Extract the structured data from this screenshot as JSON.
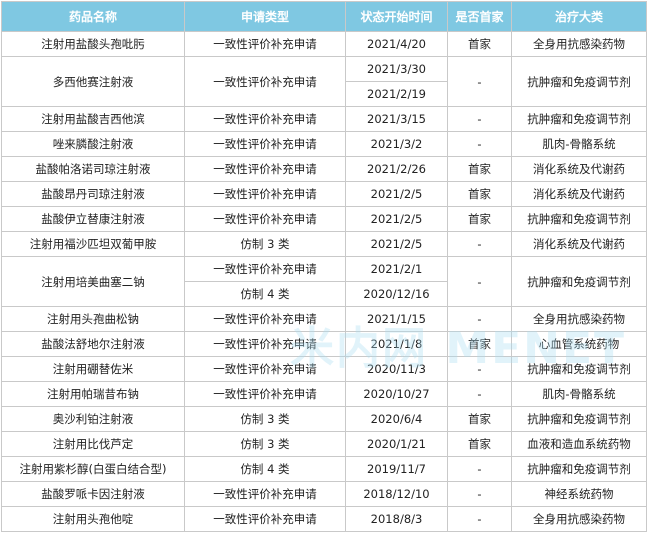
{
  "table": {
    "headers": [
      "药品名称",
      "申请类型",
      "状态开始时间",
      "是否首家",
      "治疗大类"
    ],
    "rows": [
      {
        "name": "注射用盐酸头孢吡肟",
        "items": [
          {
            "type": "一致性评价补充申请",
            "date": "2021/4/20"
          }
        ],
        "first": "首家",
        "category": "全身用抗感染药物"
      },
      {
        "name": "多西他赛注射液",
        "items": [
          {
            "type": "一致性评价补充申请",
            "date": "2021/3/30"
          },
          {
            "date": "2021/2/19"
          }
        ],
        "first": "-",
        "category": "抗肿瘤和免疫调节剂"
      },
      {
        "name": "注射用盐酸吉西他滨",
        "items": [
          {
            "type": "一致性评价补充申请",
            "date": "2021/3/15"
          }
        ],
        "first": "-",
        "category": "抗肿瘤和免疫调节剂"
      },
      {
        "name": "唑来膦酸注射液",
        "items": [
          {
            "type": "一致性评价补充申请",
            "date": "2021/3/2"
          }
        ],
        "first": "-",
        "category": "肌肉-骨骼系统"
      },
      {
        "name": "盐酸帕洛诺司琼注射液",
        "items": [
          {
            "type": "一致性评价补充申请",
            "date": "2021/2/26"
          }
        ],
        "first": "首家",
        "category": "消化系统及代谢药"
      },
      {
        "name": "盐酸昂丹司琼注射液",
        "items": [
          {
            "type": "一致性评价补充申请",
            "date": "2021/2/5"
          }
        ],
        "first": "首家",
        "category": "消化系统及代谢药"
      },
      {
        "name": "盐酸伊立替康注射液",
        "items": [
          {
            "type": "一致性评价补充申请",
            "date": "2021/2/5"
          }
        ],
        "first": "首家",
        "category": "抗肿瘤和免疫调节剂"
      },
      {
        "name": "注射用福沙匹坦双葡甲胺",
        "items": [
          {
            "type": "仿制 3 类",
            "date": "2021/2/5"
          }
        ],
        "first": "-",
        "category": "消化系统及代谢药"
      },
      {
        "name": "注射用培美曲塞二钠",
        "items": [
          {
            "type": "一致性评价补充申请",
            "date": "2021/2/1"
          },
          {
            "type": "仿制 4 类",
            "date": "2020/12/16"
          }
        ],
        "first": "-",
        "category": "抗肿瘤和免疫调节剂"
      },
      {
        "name": "注射用头孢曲松钠",
        "items": [
          {
            "type": "一致性评价补充申请",
            "date": "2021/1/15"
          }
        ],
        "first": "-",
        "category": "全身用抗感染药物"
      },
      {
        "name": "盐酸法舒地尔注射液",
        "items": [
          {
            "type": "一致性评价补充申请",
            "date": "2021/1/8"
          }
        ],
        "first": "首家",
        "category": "心血管系统药物"
      },
      {
        "name": "注射用硼替佐米",
        "items": [
          {
            "type": "一致性评价补充申请",
            "date": "2020/11/3"
          }
        ],
        "first": "-",
        "category": "抗肿瘤和免疫调节剂"
      },
      {
        "name": "注射用帕瑞昔布钠",
        "items": [
          {
            "type": "一致性评价补充申请",
            "date": "2020/10/27"
          }
        ],
        "first": "-",
        "category": "肌肉-骨骼系统"
      },
      {
        "name": "奥沙利铂注射液",
        "items": [
          {
            "type": "仿制 3 类",
            "date": "2020/6/4"
          }
        ],
        "first": "首家",
        "category": "抗肿瘤和免疫调节剂"
      },
      {
        "name": "注射用比伐芦定",
        "items": [
          {
            "type": "仿制 3 类",
            "date": "2020/1/21"
          }
        ],
        "first": "首家",
        "category": "血液和造血系统药物"
      },
      {
        "name": "注射用紫杉醇(白蛋白结合型)",
        "items": [
          {
            "type": "仿制 4 类",
            "date": "2019/11/7"
          }
        ],
        "first": "-",
        "category": "抗肿瘤和免疫调节剂"
      },
      {
        "name": "盐酸罗哌卡因注射液",
        "items": [
          {
            "type": "一致性评价补充申请",
            "date": "2018/12/10"
          }
        ],
        "first": "-",
        "category": "神经系统药物"
      },
      {
        "name": "注射用头孢他啶",
        "items": [
          {
            "type": "一致性评价补充申请",
            "date": "2018/8/3"
          }
        ],
        "first": "-",
        "category": "全身用抗感染药物"
      }
    ]
  },
  "watermark": "米内网 MENET"
}
